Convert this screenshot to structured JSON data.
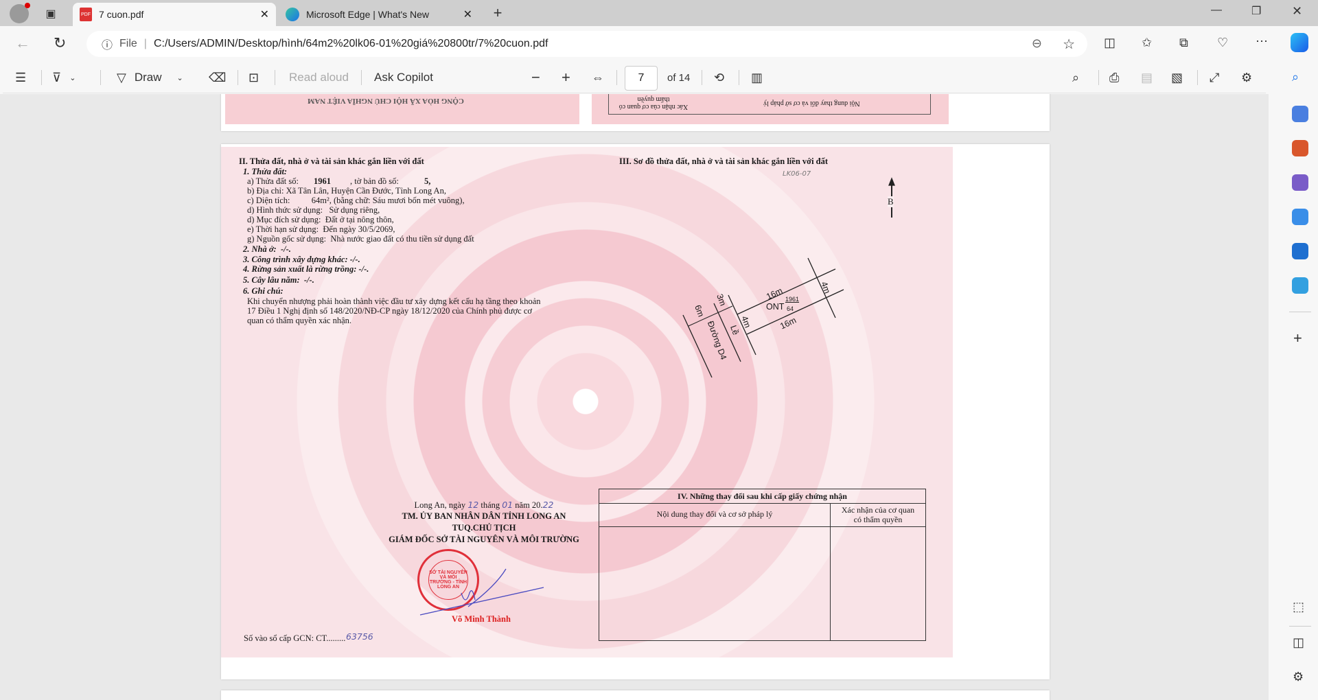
{
  "browser": {
    "tabs": [
      {
        "title": "7 cuon.pdf",
        "active": true
      },
      {
        "title": "Microsoft Edge | What's New",
        "active": false
      }
    ],
    "url_prefix": "File",
    "url": "C:/Users/ADMIN/Desktop/hình/64m2%20lk06-01%20giá%20800tr/7%20cuon.pdf"
  },
  "pdf_toolbar": {
    "draw": "Draw",
    "read_aloud": "Read aloud",
    "ask_copilot": "Ask Copilot",
    "page_current": "7",
    "page_total": "of 14"
  },
  "prev_page": {
    "header_mirrored": "CỘNG HÒA XÃ HỘI CHỦ NGHĨA VIỆT NAM",
    "col1": "Nội dung thay đổi và cơ sở pháp lý",
    "col2": "Xác nhận của cơ quan có thẩm quyền"
  },
  "certificate": {
    "section2": {
      "title": "II. Thửa đất, nhà ở và tài sản khác gắn liền với đất",
      "s1": "1. Thửa đất:",
      "a_label": "a) Thửa đất số:",
      "a_value": "1961",
      "a_map_label": ", tờ bản đồ số:",
      "a_map_value": "5,",
      "b": "b) Địa chỉ:  Xã Tân Lân, Huyện Cần Đước, Tỉnh Long An,",
      "c": "c) Diện tích:          64m², (bằng chữ: Sáu mươi bốn mét vuông),",
      "d1": "d) Hình thức sử dụng:   Sử dụng riêng,",
      "d2": "d) Mục đích sử dụng:  Đất ở tại nông thôn,",
      "e": "e) Thời hạn sử dụng:  Đến ngày 30/5/2069,",
      "g": "g) Nguồn gốc sử dụng:  Nhà nước giao đất có thu tiền sử dụng đất",
      "s2": "2. Nhà ở:  -/-.",
      "s3": "3. Công trình xây dựng khác: -/-.",
      "s4": "4. Rừng sản xuất là rừng trồng: -/-.",
      "s5": "5. Cây lâu năm:  -/-.",
      "s6": "6. Ghi chú:",
      "note1": "Khi chuyển nhượng phải hoàn thành việc đầu tư xây dựng kết cấu hạ tầng theo khoản",
      "note2": "17 Điều 1 Nghị định số 148/2020/NĐ-CP ngày 18/12/2020 của Chính phủ được cơ",
      "note3": "quan có thẩm quyền xác nhận."
    },
    "section3": {
      "title": "III. Sơ đồ thửa đất, nhà ở và tài sản khác gắn liền với đất",
      "handwritten_code": "LK06-07",
      "north": "B",
      "labels": {
        "top_len": "16m",
        "bottom_len": "16m",
        "back_width": "4m",
        "front_width": "4m",
        "land_type": "ONT",
        "parcel": "1961",
        "area": "64",
        "road_width": "6m",
        "verge_width": "3m",
        "verge": "Lề",
        "road": "Đường D4"
      }
    },
    "signature": {
      "date_prefix": "Long An, ngày",
      "day": "12",
      "month_label": "tháng",
      "month": "01",
      "year_label": "năm 20.",
      "year": "22",
      "line1": "TM. ỦY BAN NHÂN DÂN TỈNH LONG AN",
      "line2": "TUQ.CHỦ TỊCH",
      "line3": "GIÁM ĐỐC SỞ TÀI NGUYÊN VÀ MÔI TRƯỜNG",
      "stamp": "SỞ TÀI NGUYÊN VÀ MÔI TRƯỜNG - TỈNH LONG AN",
      "signer": "Võ Minh Thành"
    },
    "gcn_label": "Số vào sổ cấp GCN: CT.........",
    "gcn_number": "63756",
    "section4": {
      "title": "IV. Những thay đổi sau khi cấp giấy chứng nhận",
      "col1": "Nội dung thay đổi và cơ sở pháp lý",
      "col2a": "Xác nhận của cơ quan",
      "col2b": "có thẩm quyền"
    }
  },
  "colors": {
    "cert_pink": "#f6cdd4",
    "stamp_red": "#e0303a",
    "ink_blue": "#5a5aa8",
    "edge_blue": "#1a73e8"
  }
}
